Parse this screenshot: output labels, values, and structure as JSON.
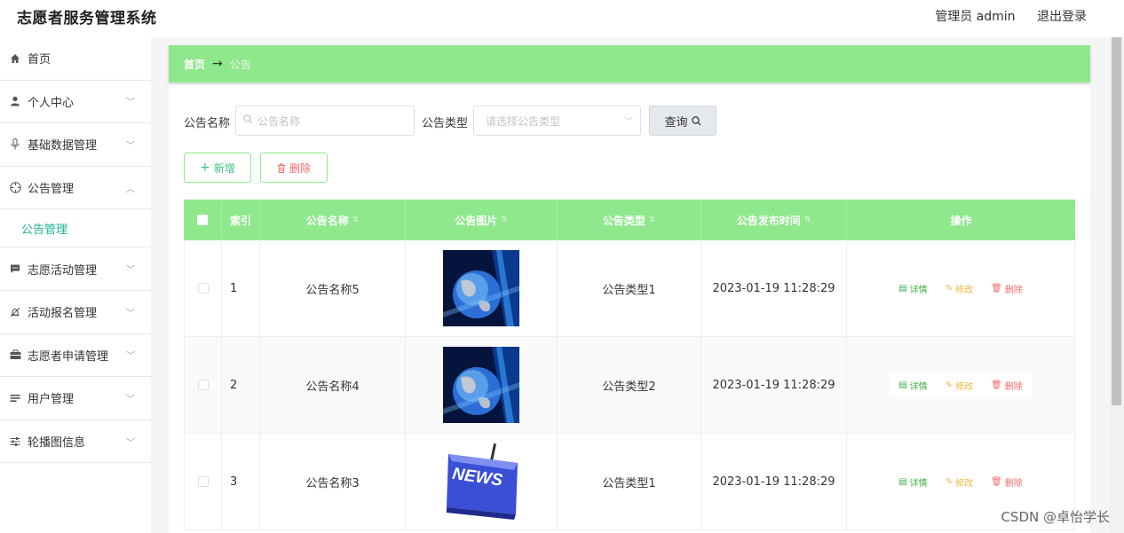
{
  "app": {
    "title": "志愿者服务管理系统"
  },
  "header": {
    "user": "管理员 admin",
    "logout": "退出登录"
  },
  "sidebar": {
    "items": [
      {
        "label": "首页",
        "icon": "home-icon"
      },
      {
        "label": "个人中心",
        "icon": "user-icon"
      },
      {
        "label": "基础数据管理",
        "icon": "microphone-icon"
      },
      {
        "label": "公告管理",
        "icon": "compass-icon",
        "expanded": true,
        "sub": "公告管理"
      },
      {
        "label": "志愿活动管理",
        "icon": "chat-icon"
      },
      {
        "label": "活动报名管理",
        "icon": "bell-icon"
      },
      {
        "label": "志愿者申请管理",
        "icon": "briefcase-icon"
      },
      {
        "label": "用户管理",
        "icon": "list-icon"
      },
      {
        "label": "轮播图信息",
        "icon": "sliders-icon"
      }
    ]
  },
  "breadcrumb": {
    "home": "首页",
    "arrow": "→",
    "current": "公告"
  },
  "search": {
    "name_label": "公告名称",
    "name_placeholder": "公告名称",
    "type_label": "公告类型",
    "type_placeholder": "请选择公告类型",
    "query_label": "查询"
  },
  "actions": {
    "add_label": "新增",
    "delete_label": "删除"
  },
  "table": {
    "headers": [
      "索引",
      "公告名称",
      "公告图片",
      "公告类型",
      "公告发布时间",
      "操作"
    ],
    "rows": [
      {
        "index": "1",
        "name": "公告名称5",
        "image": "globe-image",
        "type": "公告类型1",
        "time": "2023-01-19 11:28:29"
      },
      {
        "index": "2",
        "name": "公告名称4",
        "image": "globe-image",
        "type": "公告类型2",
        "time": "2023-01-19 11:28:29"
      },
      {
        "index": "3",
        "name": "公告名称3",
        "image": "news-key-image",
        "type": "公告类型1",
        "time": "2023-01-19 11:28:29"
      }
    ],
    "op_labels": {
      "detail": "详情",
      "edit": "修改",
      "delete": "删除"
    }
  },
  "watermark": "CSDN @卓怡学长",
  "colors": {
    "accent": "#8fe88c",
    "link": "#1bb394",
    "danger": "#f56c6c",
    "warning": "#f2b53c",
    "success": "#3cb043"
  }
}
